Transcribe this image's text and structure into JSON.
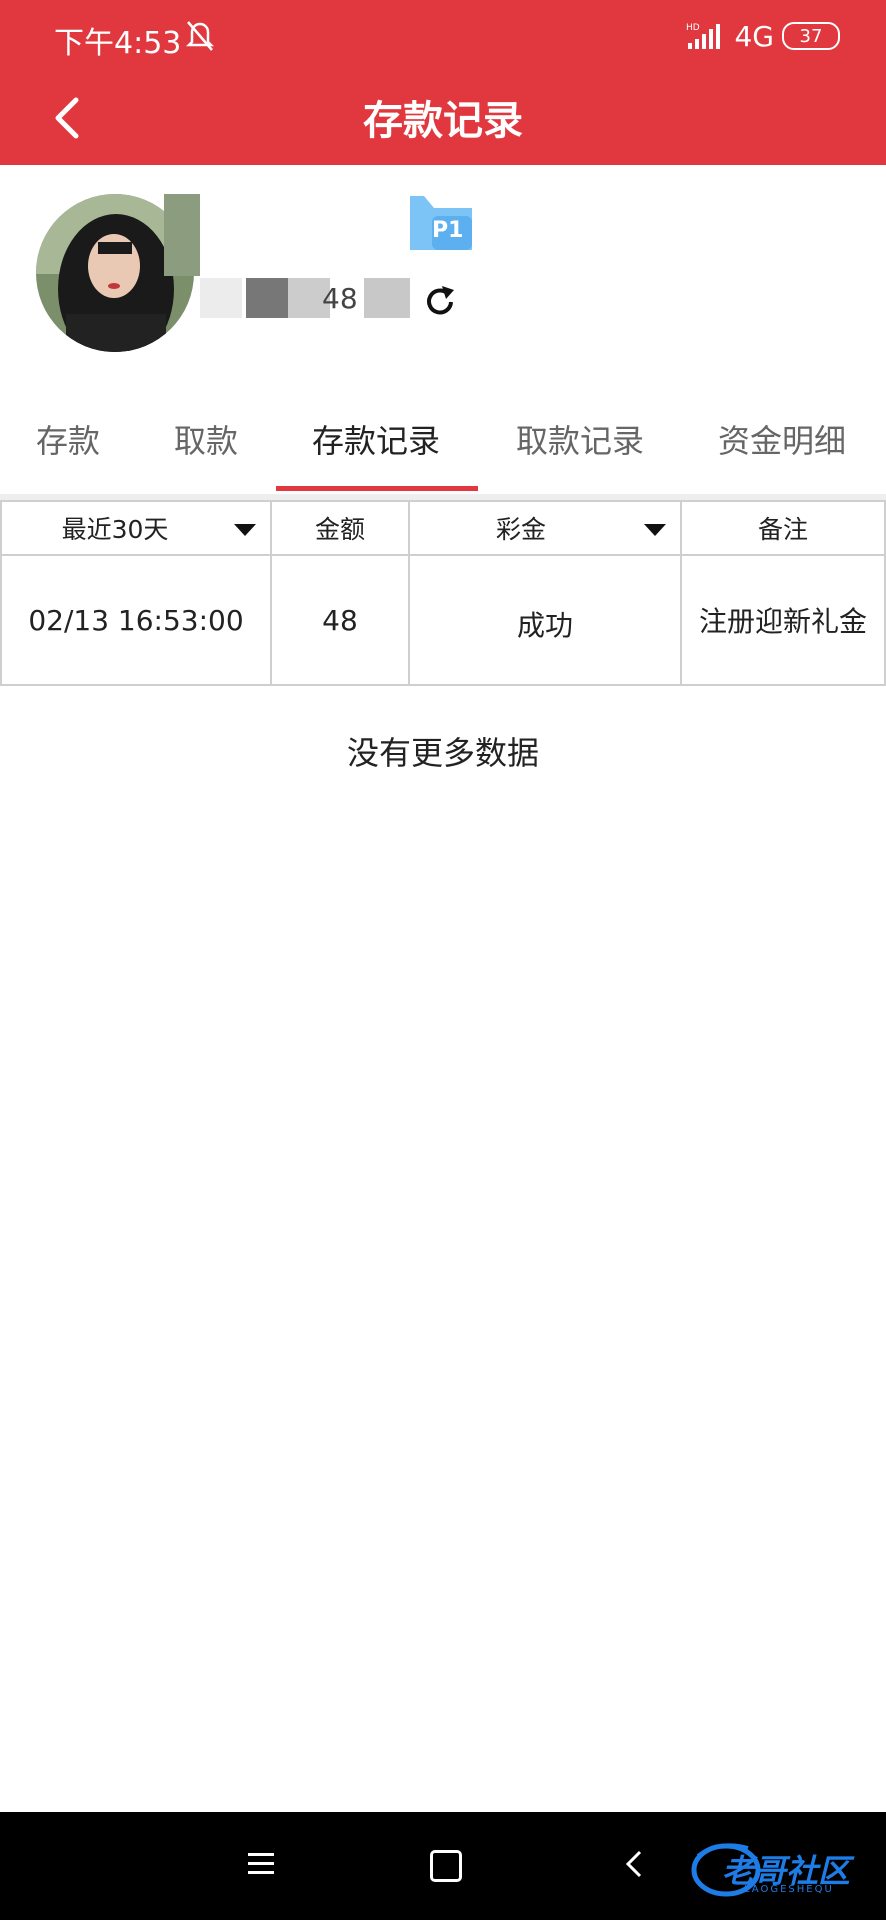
{
  "status_bar": {
    "time": "下午4:53",
    "network": "4G",
    "battery": "37"
  },
  "header": {
    "title": "存款记录",
    "back_icon": "chevron-left-icon"
  },
  "profile": {
    "vip_label": "P1",
    "balance_fragment": "48",
    "refresh_icon": "refresh-icon"
  },
  "tabs": [
    {
      "label": "存款"
    },
    {
      "label": "取款"
    },
    {
      "label": "存款记录",
      "active": true
    },
    {
      "label": "取款记录"
    },
    {
      "label": "资金明细"
    }
  ],
  "table": {
    "headers": [
      "最近30天",
      "金额",
      "彩金",
      "备注"
    ],
    "rows": [
      [
        "02/13 16:53:00",
        "48",
        "成功",
        "注册迎新礼金"
      ]
    ]
  },
  "empty_message": "没有更多数据",
  "watermark": {
    "text": "老哥社区",
    "sub": "LAOGESHEQU"
  },
  "colors": {
    "brand_red": "#e0383e",
    "watermark_blue": "#1e7ce6"
  }
}
